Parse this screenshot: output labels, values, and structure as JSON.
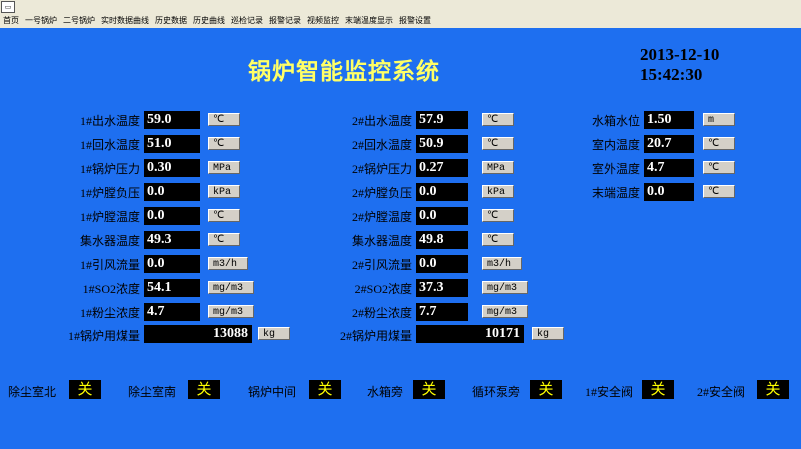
{
  "menu": [
    "首页",
    "一号锅炉",
    "二号锅炉",
    "实时数据曲线",
    "历史数据",
    "历史曲线",
    "巡检记录",
    "报警记录",
    "视频监控",
    "末端温度显示",
    "报警设置"
  ],
  "app_title": "锅炉智能监控系统",
  "date": "2013-12-10",
  "time": "15:42:30",
  "boiler1": [
    {
      "label": "1#出水温度",
      "value": "59.0",
      "unit": "℃"
    },
    {
      "label": "1#回水温度",
      "value": "51.0",
      "unit": "℃"
    },
    {
      "label": "1#锅炉压力",
      "value": "0.30",
      "unit": "MPa"
    },
    {
      "label": "1#炉膛负压",
      "value": "0.0",
      "unit": "kPa"
    },
    {
      "label": "1#炉膛温度",
      "value": "0.0",
      "unit": "℃"
    },
    {
      "label": "集水器温度",
      "value": "49.3",
      "unit": "℃"
    },
    {
      "label": "1#引风流量",
      "value": "0.0",
      "unit": "m3/h"
    },
    {
      "label": "1#SO2浓度",
      "value": "54.1",
      "unit": "mg/m3"
    },
    {
      "label": "1#粉尘浓度",
      "value": "4.7",
      "unit": "mg/m3"
    }
  ],
  "boiler1_coal": {
    "label": "1#锅炉用煤量",
    "value": "13088",
    "unit": "kg"
  },
  "boiler2": [
    {
      "label": "2#出水温度",
      "value": "57.9",
      "unit": "℃"
    },
    {
      "label": "2#回水温度",
      "value": "50.9",
      "unit": "℃"
    },
    {
      "label": "2#锅炉压力",
      "value": "0.27",
      "unit": "MPa"
    },
    {
      "label": "2#炉膛负压",
      "value": "0.0",
      "unit": "kPa"
    },
    {
      "label": "2#炉膛温度",
      "value": "0.0",
      "unit": "℃"
    },
    {
      "label": "集水器温度",
      "value": "49.8",
      "unit": "℃"
    },
    {
      "label": "2#引风流量",
      "value": "0.0",
      "unit": "m3/h"
    },
    {
      "label": "2#SO2浓度",
      "value": "37.3",
      "unit": "mg/m3"
    },
    {
      "label": "2#粉尘浓度",
      "value": "7.7",
      "unit": "mg/m3"
    }
  ],
  "boiler2_coal": {
    "label": "2#锅炉用煤量",
    "value": "10171",
    "unit": "kg"
  },
  "misc": [
    {
      "label": "水箱水位",
      "value": "1.50",
      "unit": "m"
    },
    {
      "label": "室内温度",
      "value": "20.7",
      "unit": "℃"
    },
    {
      "label": "室外温度",
      "value": "4.7",
      "unit": "℃"
    },
    {
      "label": "末端温度",
      "value": "0.0",
      "unit": "℃"
    }
  ],
  "status": [
    {
      "label": "除尘室北",
      "value": "关"
    },
    {
      "label": "除尘室南",
      "value": "关"
    },
    {
      "label": "锅炉中间",
      "value": "关"
    },
    {
      "label": "水箱旁",
      "value": "关"
    },
    {
      "label": "循环泵旁",
      "value": "关"
    },
    {
      "label": "1#安全阀",
      "value": "关"
    },
    {
      "label": "2#安全阀",
      "value": "关"
    }
  ],
  "colors": {
    "background": "#1e6ff0",
    "title": "#ffff66",
    "status_text": "#ffff00"
  }
}
